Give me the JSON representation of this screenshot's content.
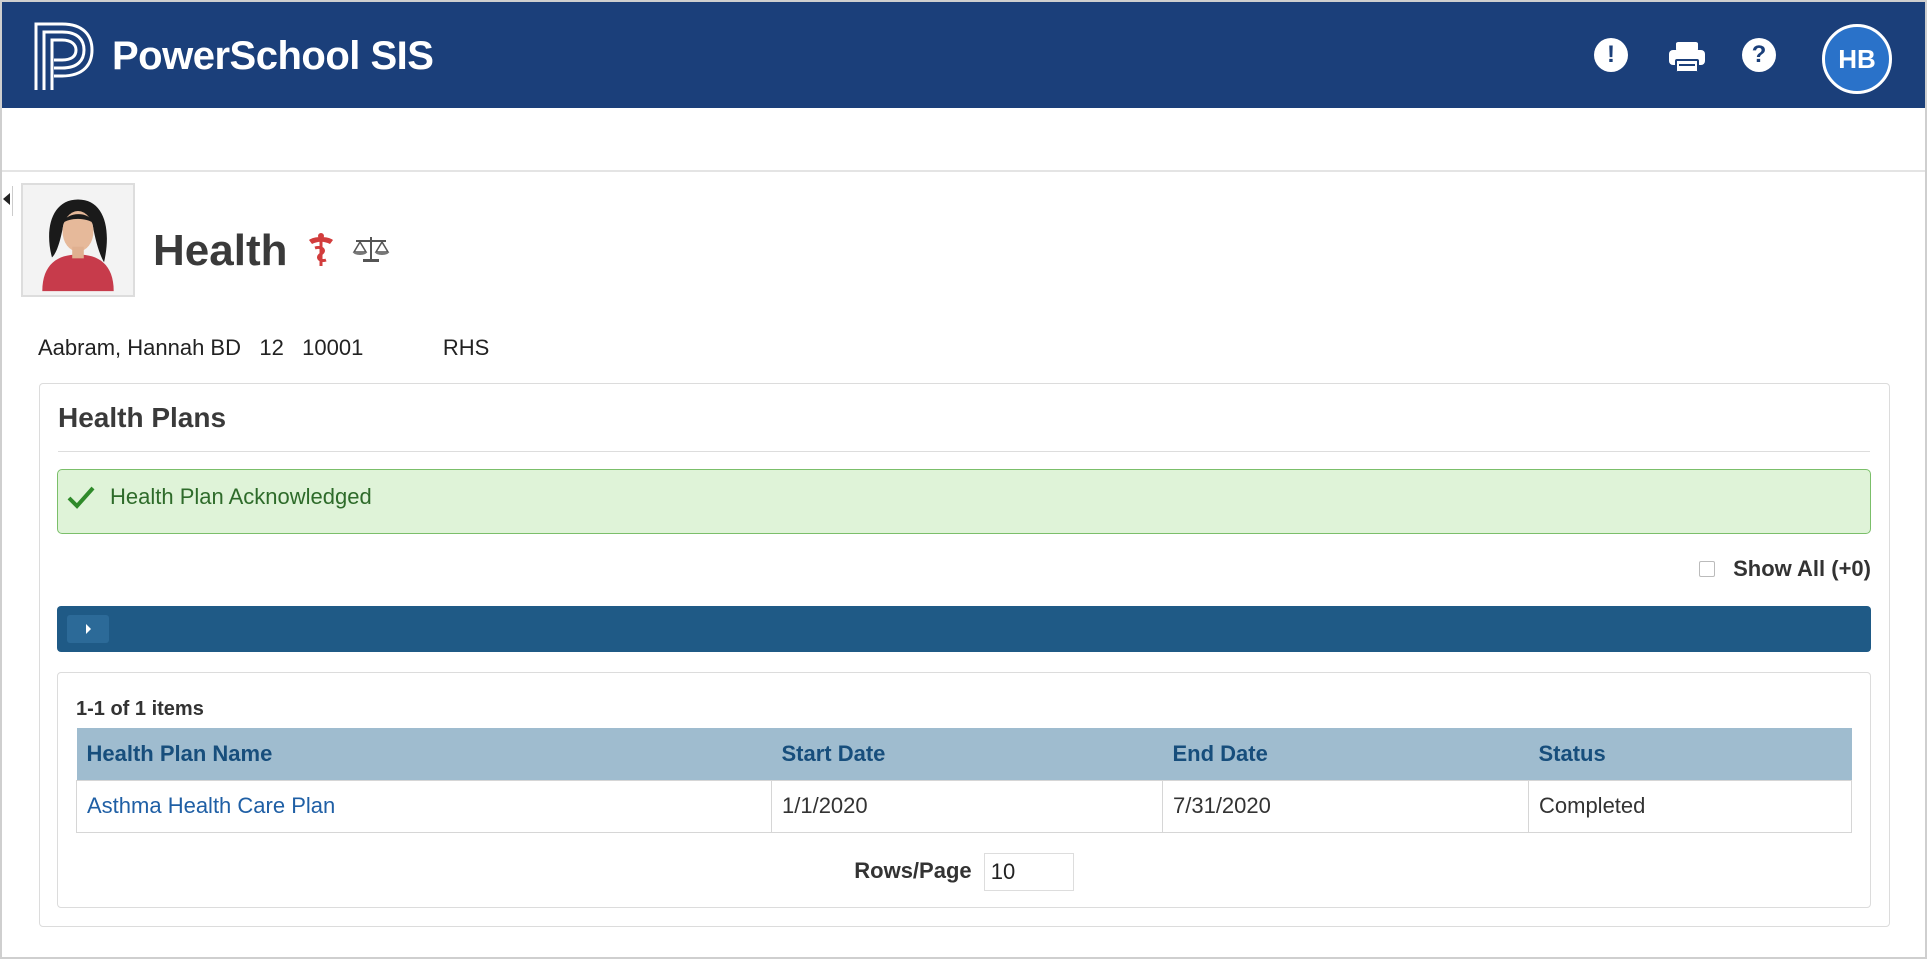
{
  "header": {
    "brand": "PowerSchool SIS",
    "alert_icon": "alert-icon",
    "print_icon": "print-icon",
    "help_icon": "help-icon",
    "user_initials": "HB",
    "bg_color": "#1b3f7a"
  },
  "page": {
    "title": "Health",
    "alert_icons": [
      "medical-alert-icon",
      "legal-alert-icon"
    ]
  },
  "student": {
    "name": "Aabram, Hannah BD",
    "grade": "12",
    "id": "10001",
    "school": "RHS"
  },
  "panel": {
    "title": "Health Plans",
    "notice": "Health Plan Acknowledged",
    "show_all_label": "Show All (+0)"
  },
  "grid": {
    "count_label": "1-1 of 1 items",
    "columns": [
      "Health Plan Name",
      "Start Date",
      "End Date",
      "Status"
    ],
    "rows": [
      {
        "name": "Asthma Health Care Plan",
        "start": "1/1/2020",
        "end": "7/31/2020",
        "status": "Completed"
      }
    ],
    "rows_per_page_label": "Rows/Page",
    "rows_per_page_value": "10"
  }
}
